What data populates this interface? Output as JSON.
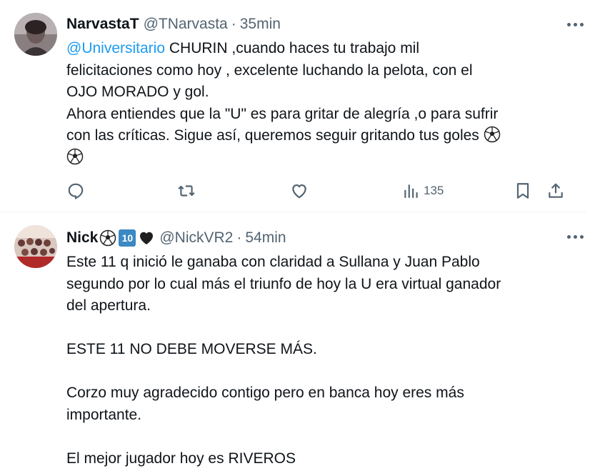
{
  "tweets": [
    {
      "name": "NarvastaT",
      "handle": "@TNarvasta",
      "separator": "·",
      "time": "35min",
      "mention": "@Universitario",
      "lines": [
        " CHURIN ,cuando haces tu trabajo mil",
        "felicitaciones como hoy , excelente luchando la pelota, con el",
        "OJO MORADO y gol.",
        "Ahora entiendes que la \"U\" es para gritar de alegría ,o para sufrir",
        "con las críticas. Sigue así, queremos seguir gritando tus goles "
      ],
      "actions": {
        "reply": "reply-icon",
        "retweet": "retweet-icon",
        "like": "heart-icon",
        "views": "135",
        "bookmark": "bookmark-icon",
        "share": "share-icon"
      }
    },
    {
      "name": "Nick",
      "name_badge_number": "10",
      "handle": "@NickVR2",
      "separator": "·",
      "time": "54min",
      "paragraphs": [
        "Este 11 q inició  le ganaba con claridad a Sullana y Juan Pablo",
        "segundo por lo cual más el triunfo de hoy la U era virtual ganador",
        "del apertura.",
        "",
        "ESTE 11 NO DEBE MOVERSE MÁS.",
        "",
        "Corzo muy agradecido contigo pero en banca hoy eres más",
        "importante.",
        "",
        "El mejor jugador hoy es RIVEROS"
      ]
    }
  ],
  "colors": {
    "text": "#0f1419",
    "secondary": "#536471",
    "link": "#1d9bf0",
    "divider": "#eff3f4"
  }
}
